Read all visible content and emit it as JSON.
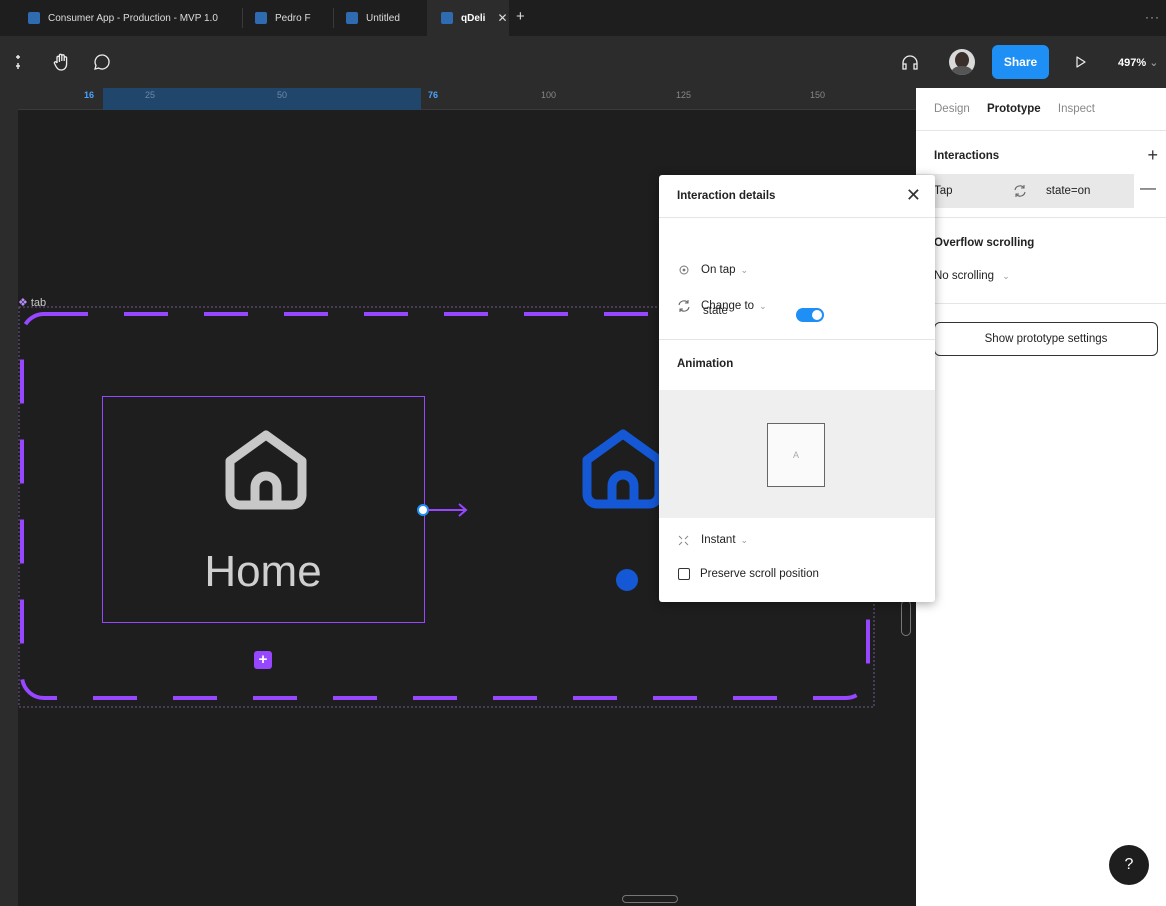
{
  "tabs": [
    {
      "label": "Consumer App - Production - MVP 1.0"
    },
    {
      "label": "Pedro F"
    },
    {
      "label": "Untitled"
    },
    {
      "label": "qDeli",
      "active": true
    }
  ],
  "toolbar": {
    "share_label": "Share",
    "zoom": "497%"
  },
  "ruler": {
    "ticks": [
      "16",
      "25",
      "50",
      "76",
      "100",
      "125",
      "150"
    ]
  },
  "canvas": {
    "component_label": "tab",
    "home_label": "Home",
    "colors": {
      "selection": "#9747ff",
      "home_inactive": "#c8c8c8",
      "home_active": "#1558d6"
    }
  },
  "popup": {
    "title": "Interaction details",
    "trigger": "On tap",
    "action": "Change to",
    "property": "state",
    "animation_title": "Animation",
    "frame_label": "A",
    "transition": "Instant",
    "preserve_scroll": "Preserve scroll position"
  },
  "panel": {
    "tabs": [
      "Design",
      "Prototype",
      "Inspect"
    ],
    "interactions_title": "Interactions",
    "interaction_trigger": "Tap",
    "interaction_value": "state=on",
    "overflow_title": "Overflow scrolling",
    "overflow_value": "No scrolling",
    "settings_button": "Show prototype settings"
  },
  "help_label": "?"
}
